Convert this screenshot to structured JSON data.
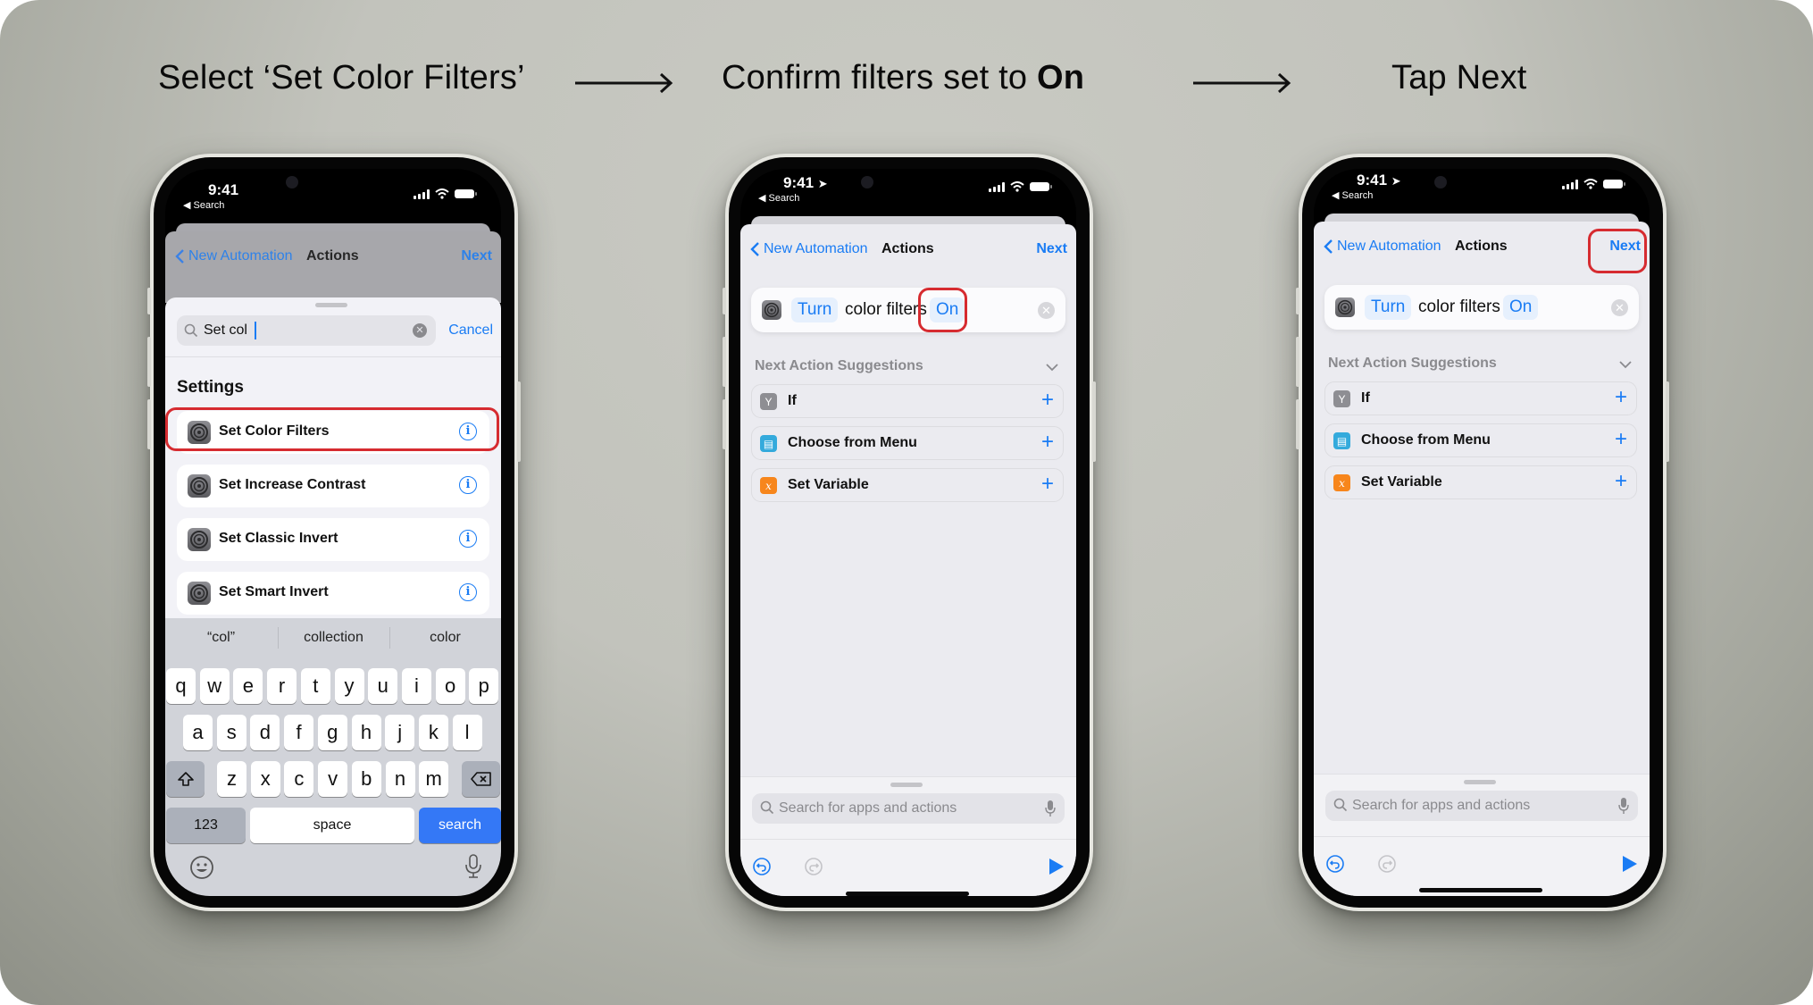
{
  "steps": [
    {
      "title_plain": "Select ‘Set Color Filters’",
      "title_bold": ""
    },
    {
      "title_plain": "Confirm filters set to ",
      "title_bold": "On"
    },
    {
      "title_plain": "Tap Next",
      "title_bold": ""
    }
  ],
  "status_bar": {
    "time": "9:41",
    "back_label": "◀ Search"
  },
  "nav": {
    "back_label": "New Automation",
    "title": "Actions",
    "next_label": "Next"
  },
  "phone1": {
    "search_value": "Set col",
    "cancel_label": "Cancel",
    "section_title": "Settings",
    "results": [
      {
        "label": "Set Color Filters",
        "icon": "settings-gear-icon",
        "highlighted": true
      },
      {
        "label": "Set Increase Contrast",
        "icon": "settings-gear-icon",
        "highlighted": false
      },
      {
        "label": "Set Classic Invert",
        "icon": "settings-gear-icon",
        "highlighted": false
      },
      {
        "label": "Set Smart Invert",
        "icon": "settings-gear-icon",
        "highlighted": false
      }
    ],
    "keyboard": {
      "suggestions": [
        "“col”",
        "collection",
        "color"
      ],
      "row1": [
        "q",
        "w",
        "e",
        "r",
        "t",
        "y",
        "u",
        "i",
        "o",
        "p"
      ],
      "row2": [
        "a",
        "s",
        "d",
        "f",
        "g",
        "h",
        "j",
        "k",
        "l"
      ],
      "row3": [
        "z",
        "x",
        "c",
        "v",
        "b",
        "n",
        "m"
      ],
      "numbers_label": "123",
      "space_label": "space",
      "search_label": "search"
    }
  },
  "action": {
    "verb": "Turn",
    "subject": "color filters",
    "state": "On"
  },
  "suggestions": {
    "header": "Next Action Suggestions",
    "items": [
      {
        "label": "If",
        "icon": "if-branch-icon",
        "color": "#8e8e93"
      },
      {
        "label": "Choose from Menu",
        "icon": "menu-icon",
        "color": "#34aadc"
      },
      {
        "label": "Set Variable",
        "icon": "variable-icon",
        "color": "#f7861c"
      }
    ]
  },
  "bottom_search": {
    "placeholder": "Search for apps and actions"
  },
  "colors": {
    "accent": "#1a7cf4",
    "highlight": "#d62b30",
    "keyboard_search": "#3478f6"
  }
}
